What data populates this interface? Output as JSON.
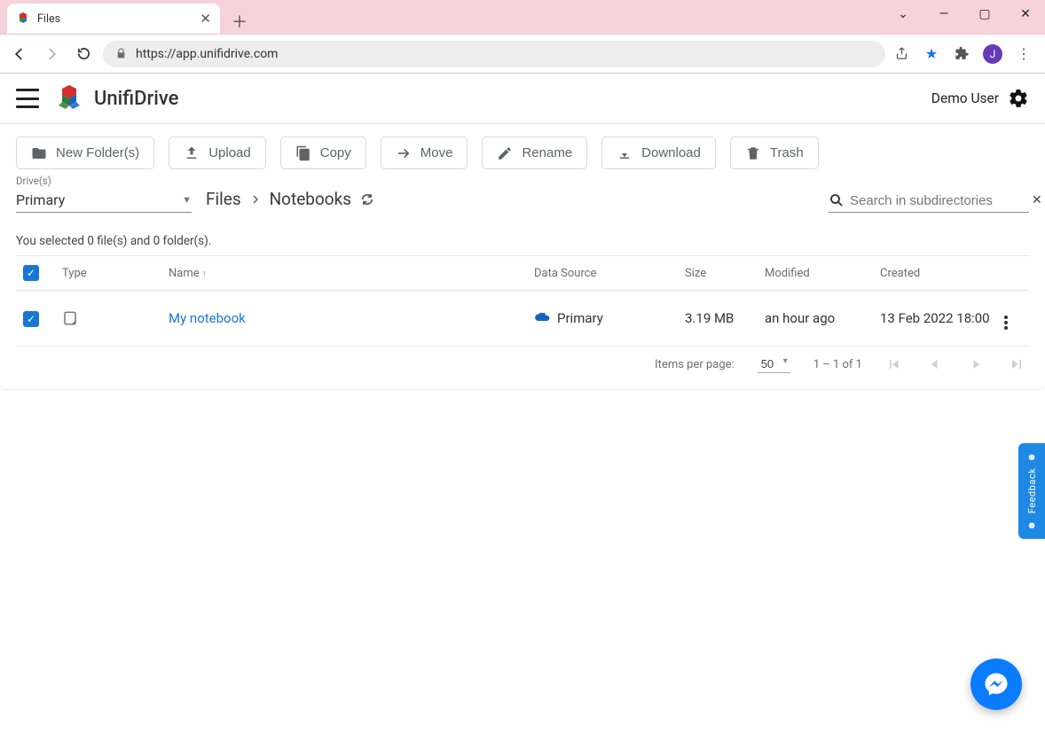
{
  "browser": {
    "tab_title": "Files",
    "url": "https://app.unifidrive.com",
    "avatar_initial": "J"
  },
  "header": {
    "brand": "UnifiDrive",
    "user_name": "Demo User"
  },
  "toolbar": {
    "new_folder": "New Folder(s)",
    "upload": "Upload",
    "copy": "Copy",
    "move": "Move",
    "rename": "Rename",
    "download": "Download",
    "trash": "Trash"
  },
  "drive": {
    "label": "Drive(s)",
    "selected": "Primary"
  },
  "breadcrumb": {
    "root": "Files",
    "current": "Notebooks"
  },
  "search": {
    "placeholder": "Search in subdirectories"
  },
  "selection_text": "You selected 0 file(s) and 0 folder(s).",
  "columns": {
    "type": "Type",
    "name": "Name",
    "data_source": "Data Source",
    "size": "Size",
    "modified": "Modified",
    "created": "Created"
  },
  "rows": [
    {
      "name": "My notebook",
      "data_source": "Primary",
      "size": "3.19 MB",
      "modified": "an hour ago",
      "created": "13 Feb 2022 18:00"
    }
  ],
  "pagination": {
    "label": "Items per page:",
    "page_size": "50",
    "range": "1 – 1 of 1"
  },
  "feedback_label": "Feedback"
}
